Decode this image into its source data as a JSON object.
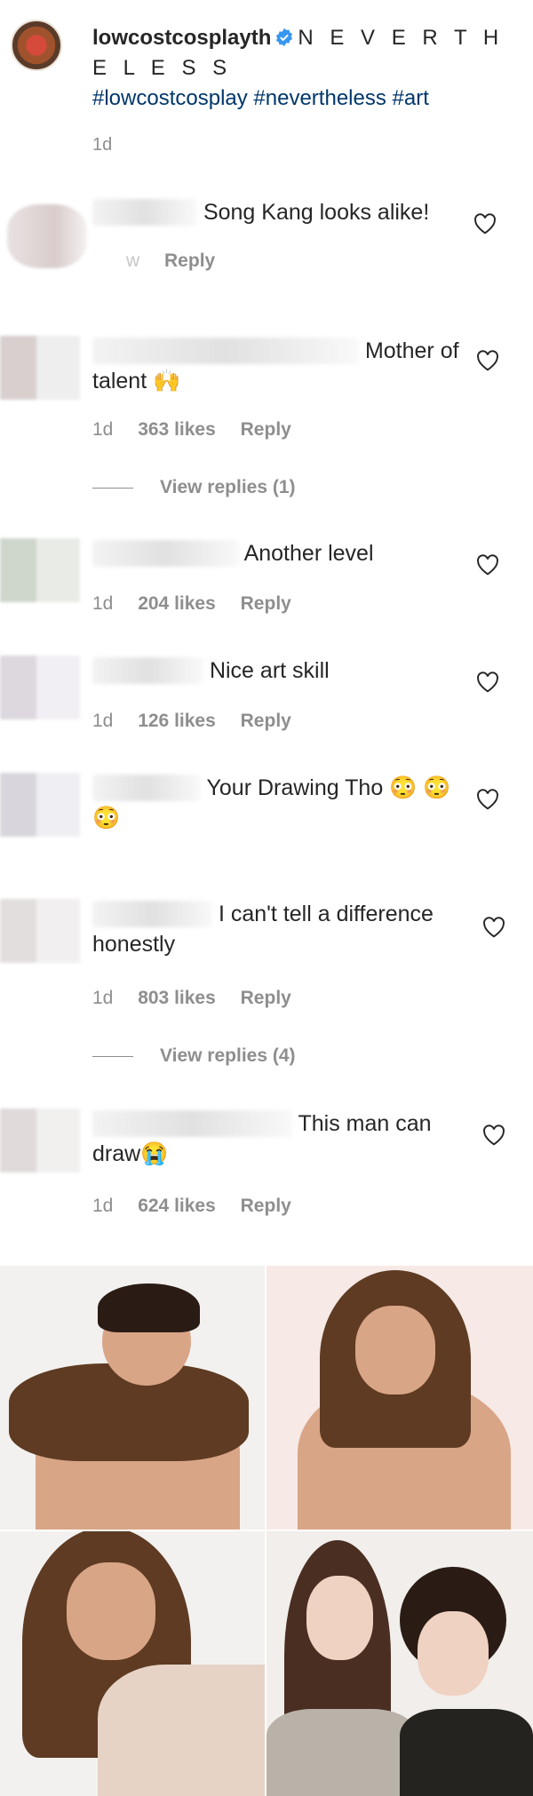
{
  "caption": {
    "username": "lowcostcosplayth",
    "text": "N E V E R T H E L E S S",
    "hashtags": "#lowcostcosplay #nevertheless #art",
    "time": "1d",
    "colors": {
      "hashtag": "#00376b",
      "verified": "#3897f0"
    }
  },
  "comments": [
    {
      "text": "Song Kang looks alike!",
      "time": "w",
      "reply": "Reply"
    },
    {
      "text": "Mother of talent 🙌",
      "time": "1d",
      "likes": "363 likes",
      "reply": "Reply",
      "view_replies": "View replies (1)"
    },
    {
      "text": "Another level",
      "time": "1d",
      "likes": "204 likes",
      "reply": "Reply"
    },
    {
      "text": "Nice art skill",
      "time": "1d",
      "likes": "126 likes",
      "reply": "Reply"
    },
    {
      "text": "Your Drawing Tho 😳 😳😳"
    },
    {
      "text": "I can't tell a difference honestly",
      "time": "1d",
      "likes": "803 likes",
      "reply": "Reply",
      "view_replies": "View replies (4)"
    },
    {
      "text": "This man can draw😭",
      "time": "1d",
      "likes": "624 likes",
      "reply": "Reply"
    }
  ],
  "icons": {
    "heart": "heart-outline-icon",
    "verified": "verified-badge-icon"
  }
}
